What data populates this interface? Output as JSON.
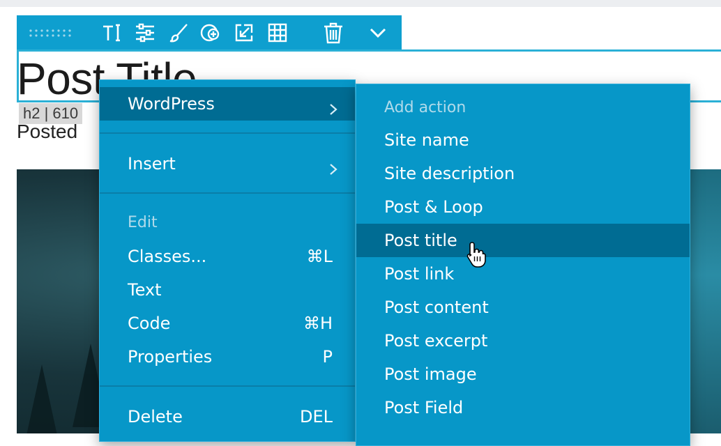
{
  "page": {
    "title": "Post Title",
    "tag": "h2 | 610",
    "posted": "Posted"
  },
  "toolbar": {
    "buttons": [
      {
        "icon": "drag-handle-icon"
      },
      {
        "icon": "text-style-icon"
      },
      {
        "icon": "sliders-icon"
      },
      {
        "icon": "brush-icon"
      },
      {
        "icon": "add-circle-icon"
      },
      {
        "icon": "import-icon"
      },
      {
        "icon": "grid-icon"
      },
      {
        "icon": "trash-icon"
      },
      {
        "icon": "chevron-down-icon"
      }
    ]
  },
  "menu": {
    "wordpress": "WordPress",
    "insert": "Insert",
    "edit_heading": "Edit",
    "classes": "Classes...",
    "classes_shortcut": "⌘L",
    "text": "Text",
    "code": "Code",
    "code_shortcut": "⌘H",
    "properties": "Properties",
    "properties_shortcut": "P",
    "delete": "Delete",
    "delete_shortcut": "DEL"
  },
  "submenu": {
    "heading": "Add action",
    "items": [
      "Site name",
      "Site description",
      "Post & Loop",
      "Post title",
      "Post link",
      "Post content",
      "Post excerpt",
      "Post image",
      "Post Field"
    ]
  },
  "colors": {
    "menu_bg": "#0797c8",
    "menu_active": "#006c93",
    "toolbar_bg": "#0e9fcf"
  }
}
